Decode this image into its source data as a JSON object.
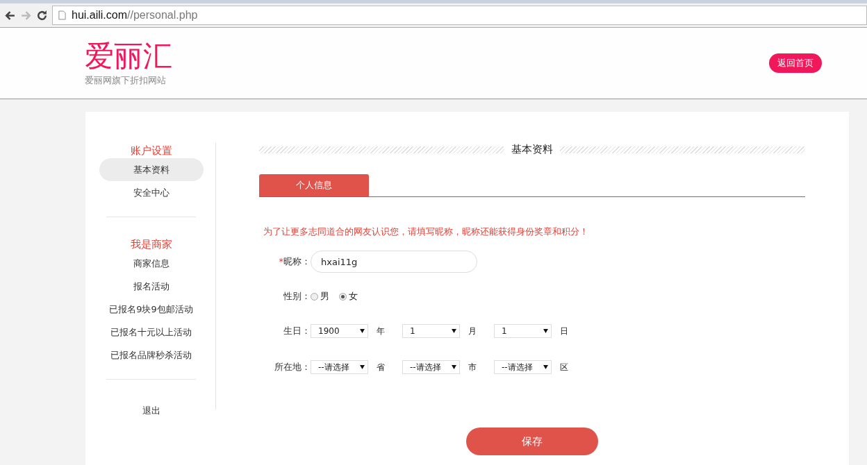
{
  "browser": {
    "url_host": "hui.aili.com",
    "url_path": "//personal.php"
  },
  "header": {
    "logo": "爱丽汇",
    "tagline": "爱丽网旗下折扣网站",
    "home_button": "返回首页"
  },
  "sidebar": {
    "sections": [
      {
        "title": "账户设置",
        "items": [
          {
            "label": "基本资料",
            "selected": true
          },
          {
            "label": "安全中心",
            "selected": false
          }
        ]
      },
      {
        "title": "我是商家",
        "items": [
          {
            "label": "商家信息",
            "selected": false
          },
          {
            "label": "报名活动",
            "selected": false
          },
          {
            "label": "已报名9块9包邮活动",
            "selected": false
          },
          {
            "label": "已报名十元以上活动",
            "selected": false
          },
          {
            "label": "已报名品牌秒杀活动",
            "selected": false
          }
        ]
      },
      {
        "items": [
          {
            "label": "退出",
            "selected": false
          }
        ]
      }
    ]
  },
  "main": {
    "heading": "基本资料",
    "tabs": [
      {
        "label": "个人信息",
        "selected": true
      }
    ],
    "notice": "为了让更多志同道合的网友认识您，请填写昵称，昵称还能获得身份奖章和积分！",
    "nickname": {
      "required_mark": "*",
      "label": "昵称：",
      "value": "hxai11g"
    },
    "gender": {
      "label": "性别：",
      "options": [
        {
          "label": "男",
          "selected": false
        },
        {
          "label": "女",
          "selected": true
        }
      ]
    },
    "birthday": {
      "label": "生日：",
      "selects": [
        {
          "value": "1900",
          "unit": "年"
        },
        {
          "value": "1",
          "unit": "月"
        },
        {
          "value": "1",
          "unit": "日"
        }
      ]
    },
    "location": {
      "label": "所在地：",
      "selects": [
        {
          "value": "--请选择",
          "unit": "省"
        },
        {
          "value": "--请选择",
          "unit": "市"
        },
        {
          "value": "--请选择",
          "unit": "区"
        }
      ]
    },
    "save_button": "保存"
  }
}
